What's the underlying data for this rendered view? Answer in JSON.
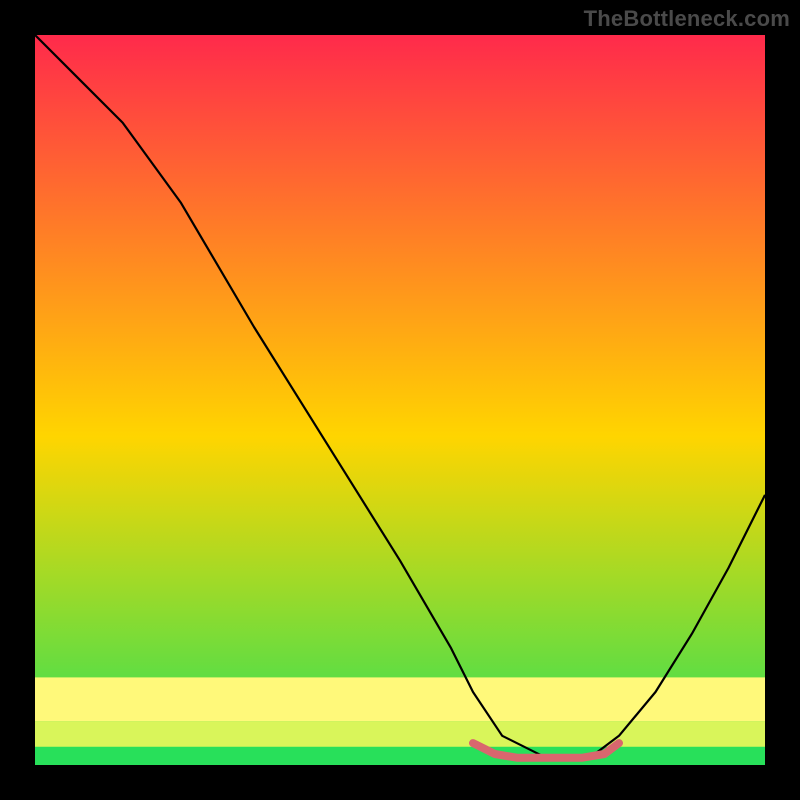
{
  "watermark": "TheBottleneck.com",
  "chart_data": {
    "type": "line",
    "title": "",
    "xlabel": "",
    "ylabel": "",
    "xlim": [
      0,
      100
    ],
    "ylim": [
      0,
      100
    ],
    "grid": false,
    "legend": false,
    "background_gradient": {
      "top_color": "#ff2a4b",
      "mid_color": "#ffd500",
      "bottom_color": "#28e05a"
    },
    "series": [
      {
        "name": "curve-main",
        "color": "#000000",
        "x": [
          0,
          6,
          12,
          20,
          30,
          40,
          50,
          57,
          60,
          64,
          70,
          76,
          80,
          85,
          90,
          95,
          100
        ],
        "values": [
          100,
          94,
          88,
          77,
          60,
          44,
          28,
          16,
          10,
          4,
          1,
          1,
          4,
          10,
          18,
          27,
          37
        ]
      },
      {
        "name": "highlight-trough",
        "color": "#d9666e",
        "x": [
          60,
          63,
          66,
          69,
          72,
          75,
          78,
          80
        ],
        "values": [
          3,
          1.5,
          1,
          1,
          1,
          1,
          1.5,
          3
        ]
      }
    ],
    "bottom_bands": [
      {
        "y_from": 0,
        "y_to": 2.5,
        "color": "#28e05a"
      },
      {
        "y_from": 2.5,
        "y_to": 6,
        "color": "#d9f55a"
      },
      {
        "y_from": 6,
        "y_to": 12,
        "color": "#fff97a"
      }
    ]
  }
}
